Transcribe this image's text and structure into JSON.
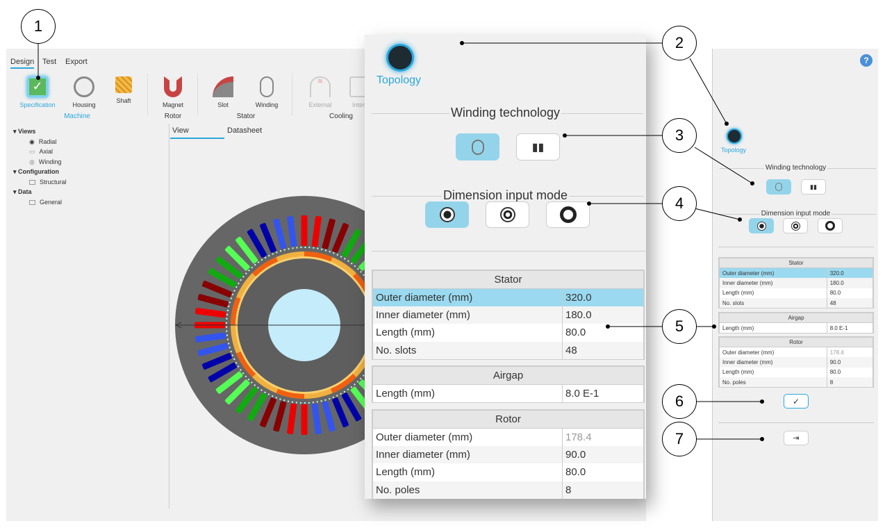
{
  "tabs": [
    "Design",
    "Test",
    "Export"
  ],
  "toolbar": {
    "items": [
      {
        "label": "Specification",
        "icon": "specification-check-icon"
      },
      {
        "label": "Housing",
        "icon": "housing-icon"
      },
      {
        "label": "Shaft",
        "icon": "shaft-icon"
      },
      {
        "label": "Magnet",
        "icon": "magnet-icon"
      },
      {
        "label": "Slot",
        "icon": "slot-icon"
      },
      {
        "label": "Winding",
        "icon": "winding-icon"
      },
      {
        "label": "External",
        "icon": "external-cooling-icon"
      },
      {
        "label": "Inter",
        "icon": "internal-cooling-icon"
      }
    ],
    "groups": [
      "Machine",
      "Rotor",
      "Stator",
      "Cooling"
    ]
  },
  "tree": {
    "views": "Views",
    "radial": "Radial",
    "axial": "Axial",
    "winding": "Winding",
    "configuration": "Configuration",
    "structural": "Structural",
    "data": "Data",
    "general": "General"
  },
  "view_tabs": [
    "View",
    "Datasheet"
  ],
  "panel": {
    "topology": "Topology",
    "winding_technology": "Winding technology",
    "dimension_input_mode": "Dimension input mode",
    "stator": {
      "title": "Stator",
      "rows": [
        [
          "Outer diameter (mm)",
          "320.0"
        ],
        [
          "Inner diameter (mm)",
          "180.0"
        ],
        [
          "Length (mm)",
          "80.0"
        ],
        [
          "No. slots",
          "48"
        ]
      ]
    },
    "airgap": {
      "title": "Airgap",
      "rows": [
        [
          "Length (mm)",
          "8.0 E-1"
        ]
      ]
    },
    "rotor": {
      "title": "Rotor",
      "rows": [
        [
          "Outer diameter (mm)",
          "178.4"
        ],
        [
          "Inner diameter (mm)",
          "90.0"
        ],
        [
          "Length (mm)",
          "80.0"
        ],
        [
          "No. poles",
          "8"
        ]
      ]
    }
  },
  "callouts": [
    "1",
    "2",
    "3",
    "4",
    "5",
    "6",
    "7"
  ],
  "help": "?",
  "colors": {
    "accent": "#2aa7dc",
    "selected": "#9ad9ef",
    "stator": "#666666",
    "shaft": "#c4ecfb"
  }
}
